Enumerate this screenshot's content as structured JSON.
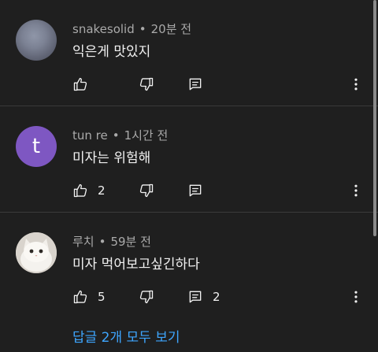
{
  "comments": [
    {
      "author": "snakesolid",
      "time": "20분 전",
      "text": "익은게 맛있지",
      "likes": "",
      "replies": "",
      "avatar_type": "photo-blurred"
    },
    {
      "author": "tun re",
      "time": "1시간 전",
      "text": "미자는 위험해",
      "likes": "2",
      "replies": "",
      "avatar_letter": "t",
      "avatar_color": "#7e57c2"
    },
    {
      "author": "루치",
      "time": "59분 전",
      "text": "미자 먹어보고싶긴하다",
      "likes": "5",
      "replies": "2",
      "avatar_type": "photo-white-cat"
    }
  ],
  "separator": "•",
  "view_replies_label": "답글 2개 모두 보기",
  "icons": [
    "thumb-up-icon",
    "thumb-down-icon",
    "reply-icon",
    "more-vert-icon"
  ],
  "colors": {
    "background": "#1f1f1f",
    "link": "#3ea6ff",
    "meta": "#aaaaaa"
  }
}
